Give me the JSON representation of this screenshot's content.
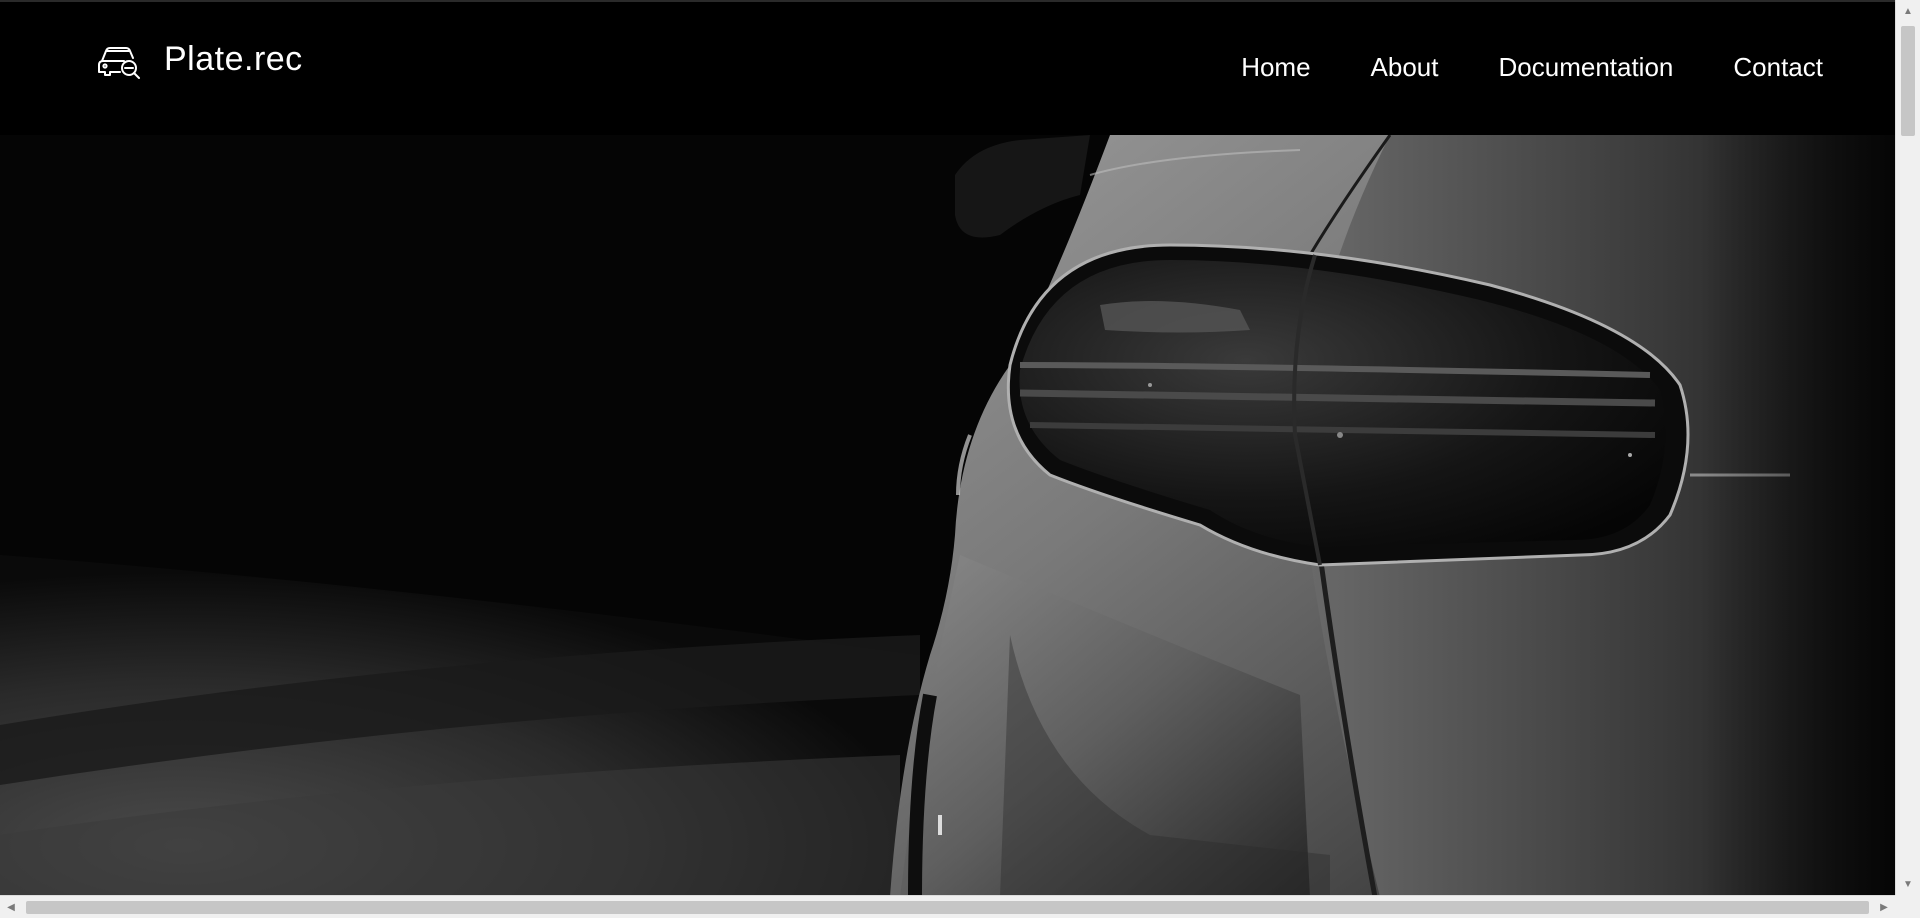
{
  "brand": {
    "name": "Plate.rec",
    "icon": "car-search-icon"
  },
  "nav": {
    "items": [
      {
        "label": "Home"
      },
      {
        "label": "About"
      },
      {
        "label": "Documentation"
      },
      {
        "label": "Contact"
      }
    ]
  },
  "hero": {
    "image": "car-taillight-photo"
  },
  "scrollbars": {
    "vertical": {
      "up_icon": "arrow-up-icon",
      "down_icon": "arrow-down-icon"
    },
    "horizontal": {
      "left_icon": "arrow-left-icon",
      "right_icon": "arrow-right-icon"
    }
  },
  "colors": {
    "background": "#000000",
    "text": "#ffffff",
    "scrollbar_track": "#f0f0f0",
    "scrollbar_thumb": "#c6c6c6"
  }
}
